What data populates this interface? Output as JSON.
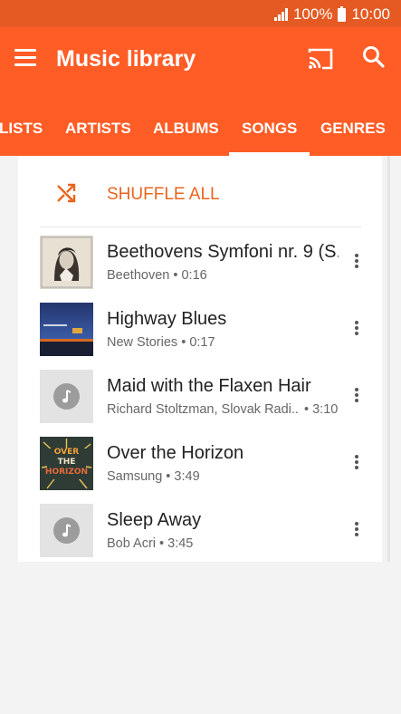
{
  "status_bar": {
    "battery_percent": "100%",
    "time": "10:00"
  },
  "app_bar": {
    "title": "Music library",
    "icons": [
      "menu-icon",
      "cast-icon",
      "search-icon"
    ]
  },
  "tabs": [
    {
      "label": "LISTS",
      "active": false
    },
    {
      "label": "ARTISTS",
      "active": false
    },
    {
      "label": "ALBUMS",
      "active": false
    },
    {
      "label": "SONGS",
      "active": true
    },
    {
      "label": "GENRES",
      "active": false
    }
  ],
  "shuffle": {
    "label": "SHUFFLE ALL",
    "icon": "shuffle-icon"
  },
  "songs": [
    {
      "title": "Beethovens Symfoni nr. 9 (S..",
      "artist": "Beethoven",
      "duration": "0:16",
      "art": "beethoven-portrait"
    },
    {
      "title": "Highway Blues",
      "artist": "New Stories",
      "duration": "0:17",
      "art": "highway-album"
    },
    {
      "title": "Maid with the Flaxen Hair",
      "artist": "Richard Stoltzman, Slovak Radi..",
      "duration": "3:10",
      "art": "music-note-placeholder"
    },
    {
      "title": "Over the Horizon",
      "artist": "Samsung",
      "duration": "3:49",
      "art": "over-the-horizon-album",
      "art_text": [
        "OVER",
        "THE",
        "HORIZON"
      ]
    },
    {
      "title": "Sleep Away",
      "artist": "Bob Acri",
      "duration": "3:45",
      "art": "music-note-placeholder"
    }
  ],
  "colors": {
    "status_bar": "#e55a22",
    "app_bar": "#ff5c26",
    "accent": "#e8651f"
  }
}
